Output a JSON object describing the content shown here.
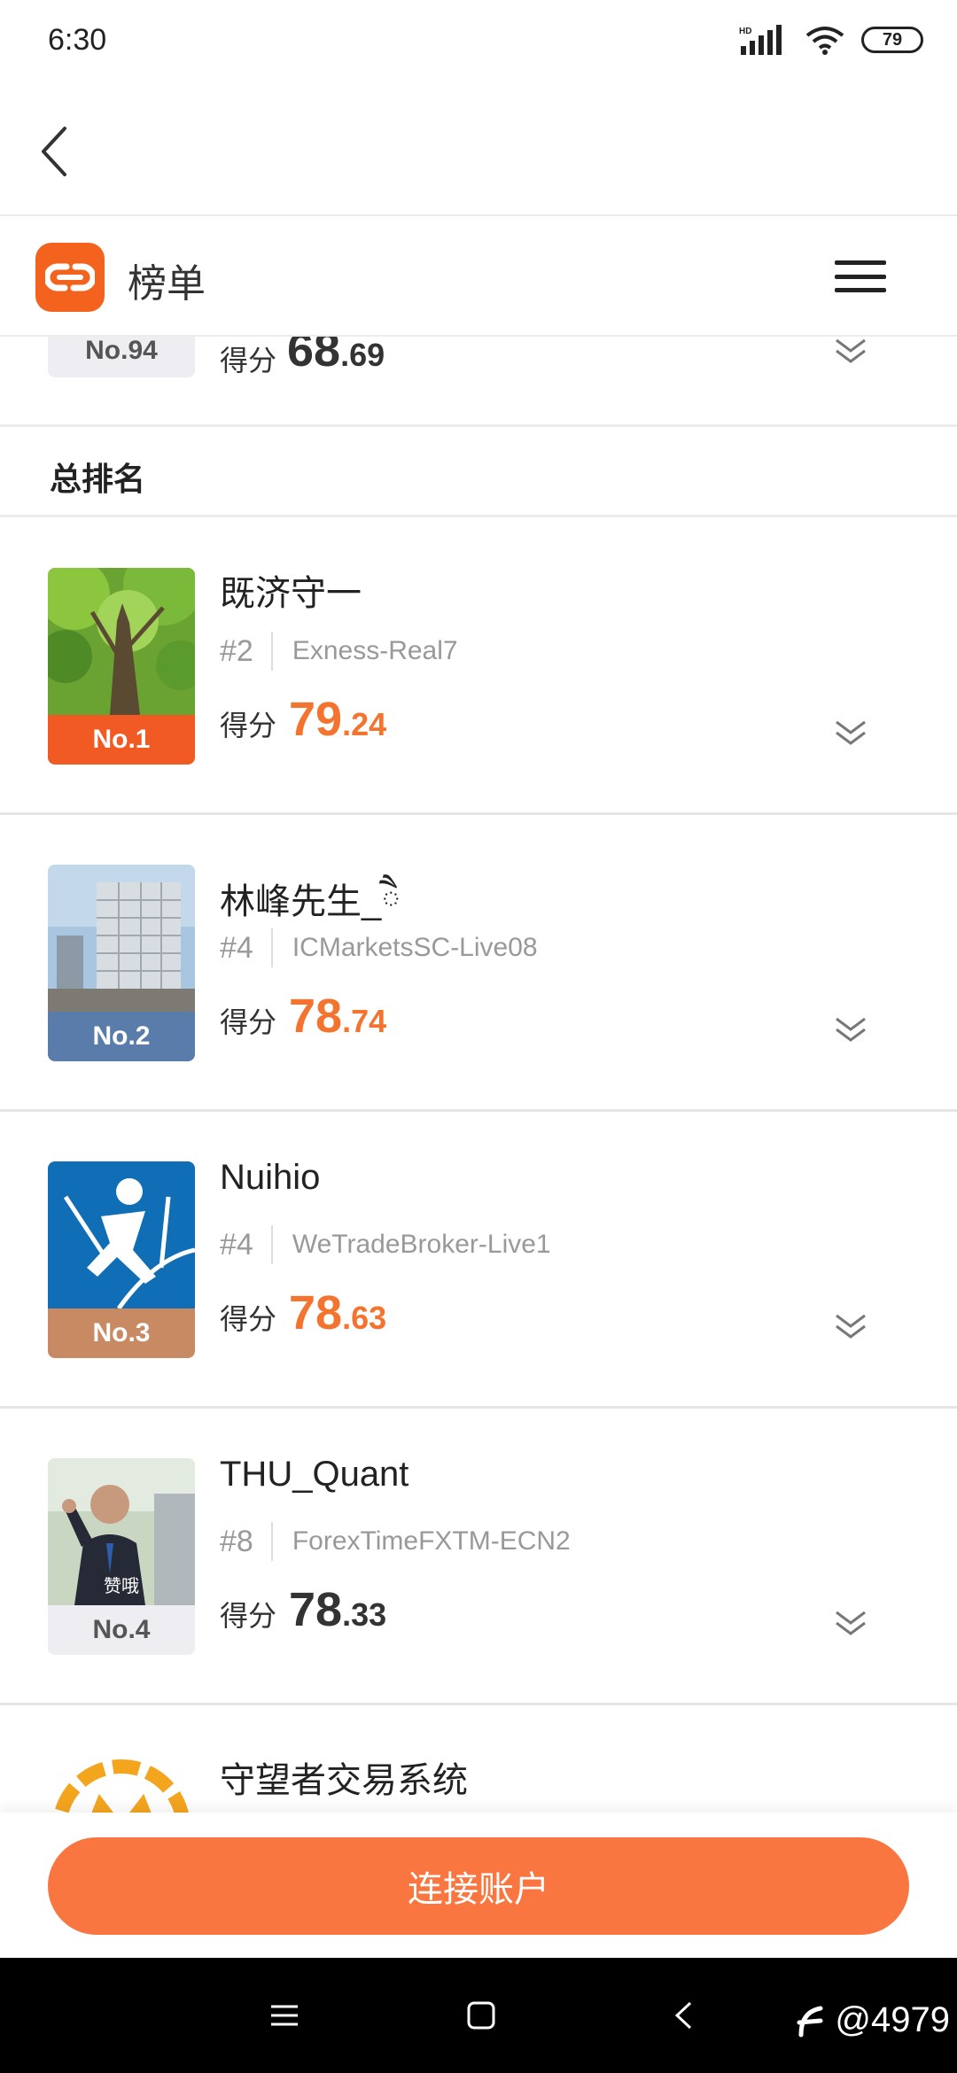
{
  "status_bar": {
    "time": "6:30",
    "battery": "79"
  },
  "header": {
    "title": "榜单"
  },
  "partial_top": {
    "rank": "No.94",
    "score_label": "得分",
    "score_int": "68",
    "score_dec": ".69"
  },
  "section": {
    "title": "总排名"
  },
  "entries": [
    {
      "name": "既济守一",
      "num": "#2",
      "server": "Exness-Real7",
      "rank": "No.1",
      "score_label": "得分",
      "score_int": "79",
      "score_dec": ".24"
    },
    {
      "name": "林峰先生_ཻ",
      "num": "#4",
      "server": "ICMarketsSC-Live08",
      "rank": "No.2",
      "score_label": "得分",
      "score_int": "78",
      "score_dec": ".74"
    },
    {
      "name": "Nuihio",
      "num": "#4",
      "server": "WeTradeBroker-Live1",
      "rank": "No.3",
      "score_label": "得分",
      "score_int": "78",
      "score_dec": ".63"
    },
    {
      "name": "THU_Quant",
      "num": "#8",
      "server": "ForexTimeFXTM-ECN2",
      "rank": "No.4",
      "score_label": "得分",
      "score_int": "78",
      "score_dec": ".33",
      "avatar_caption": "赞哦"
    },
    {
      "name": "守望者交易系统"
    }
  ],
  "bottom": {
    "connect_label": "连接账户"
  },
  "watermark": "@4979",
  "colors": {
    "accent": "#f4732e",
    "gold": "#f15a22",
    "silver": "#5a7cab",
    "bronze": "#c88a62",
    "plain": "#eeeef2"
  },
  "icons": [
    "back-arrow-icon",
    "app-logo-icon",
    "hamburger-menu-icon",
    "chevron-double-down-icon",
    "home-square-icon",
    "back-triangle-icon",
    "recents-menu-icon"
  ]
}
